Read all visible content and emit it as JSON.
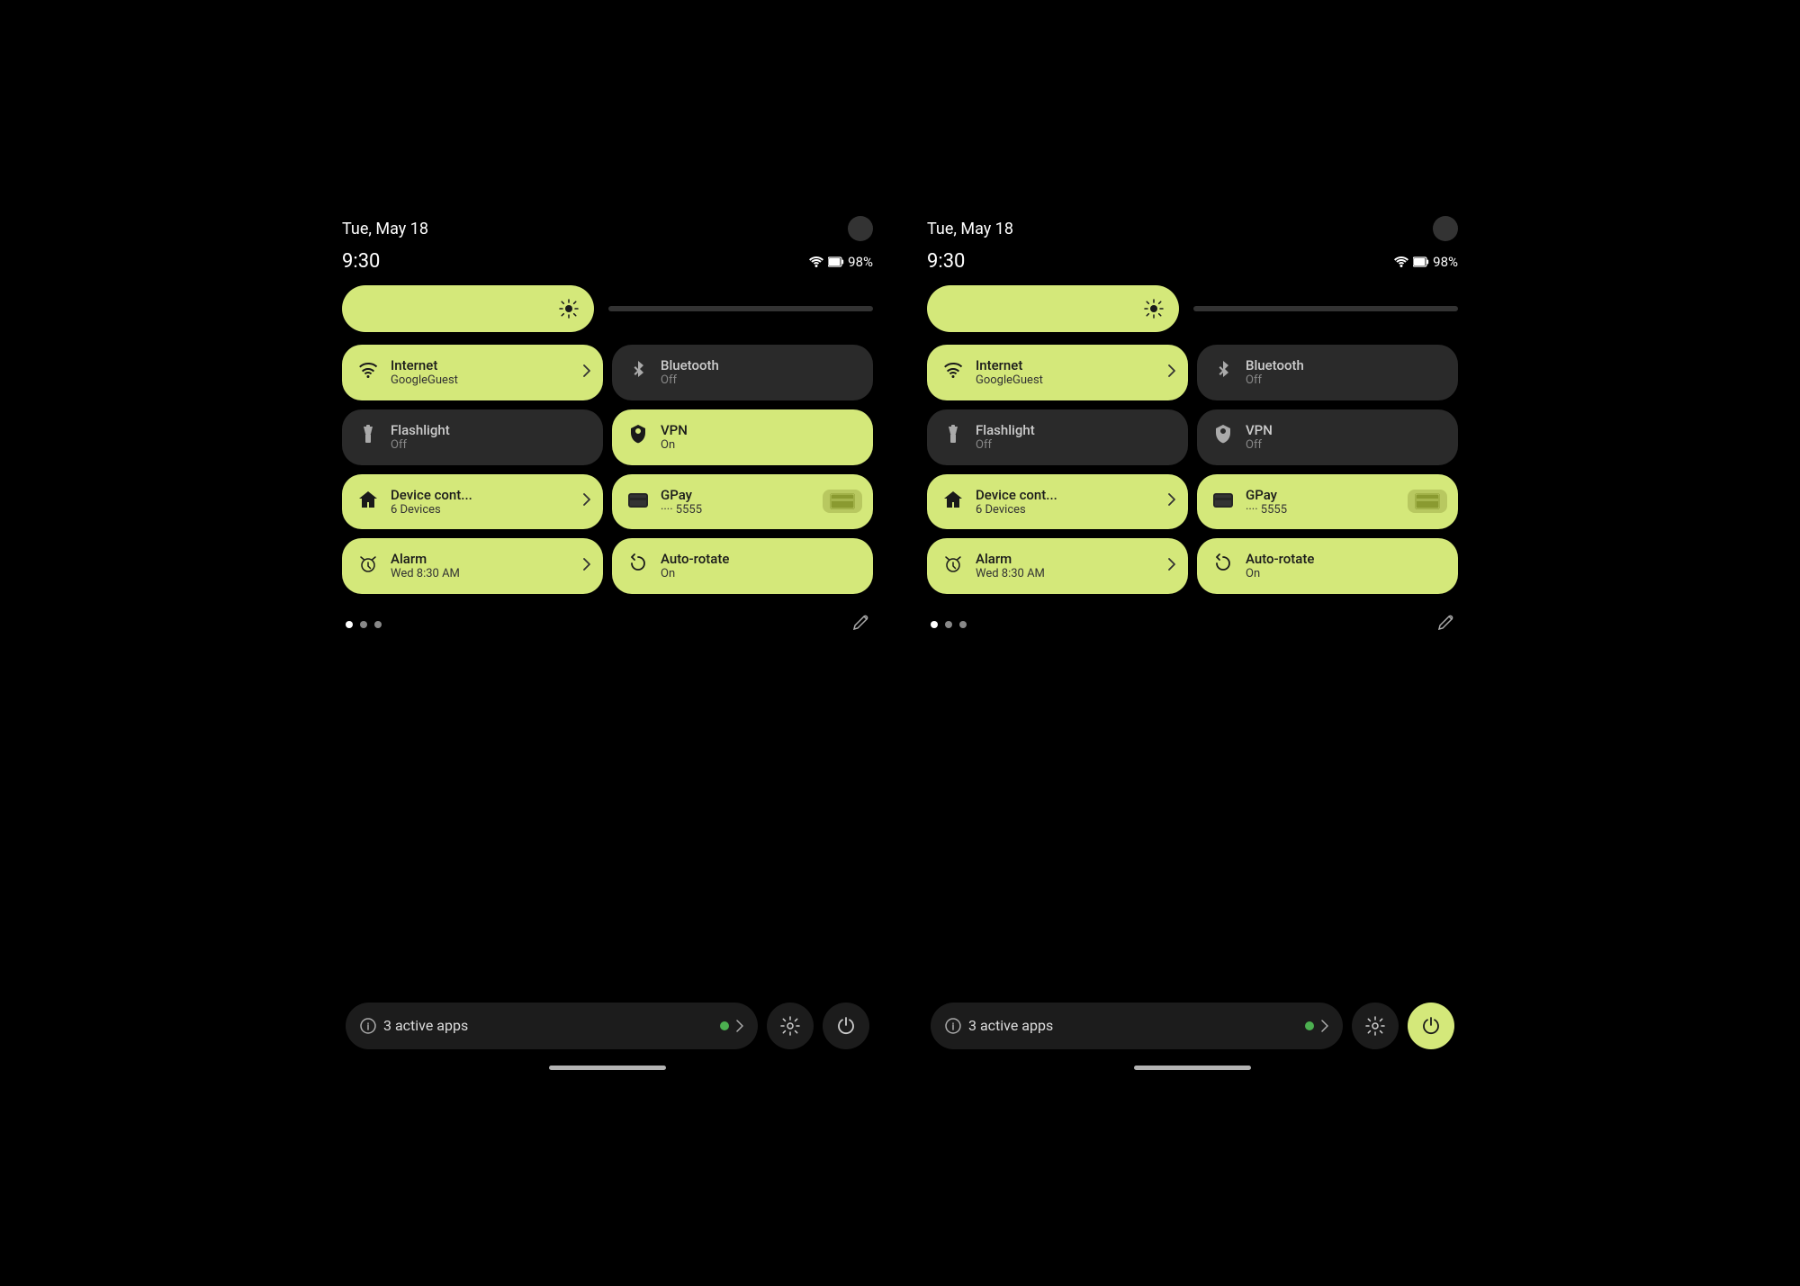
{
  "screens": [
    {
      "id": "screen-left",
      "statusBar": {
        "date": "Tue, May 18",
        "time": "9:30",
        "battery": "98%"
      },
      "brightness": {
        "icon": "⚙"
      },
      "tiles": [
        {
          "id": "internet",
          "state": "active",
          "icon": "wifi",
          "title": "Internet",
          "subtitle": "GoogleGuest",
          "hasChevron": true
        },
        {
          "id": "bluetooth",
          "state": "inactive",
          "icon": "bluetooth",
          "title": "Bluetooth",
          "subtitle": "Off",
          "hasChevron": false
        },
        {
          "id": "flashlight",
          "state": "inactive",
          "icon": "flashlight",
          "title": "Flashlight",
          "subtitle": "Off",
          "hasChevron": false
        },
        {
          "id": "vpn",
          "state": "active",
          "icon": "vpn",
          "title": "VPN",
          "subtitle": "On",
          "hasChevron": false
        },
        {
          "id": "device-control",
          "state": "active",
          "icon": "home",
          "title": "Device cont...",
          "subtitle": "6 Devices",
          "hasChevron": true
        },
        {
          "id": "gpay",
          "state": "active",
          "icon": "gpay",
          "title": "GPay",
          "subtitle": "···· 5555",
          "hasCard": true
        },
        {
          "id": "alarm",
          "state": "active",
          "icon": "alarm",
          "title": "Alarm",
          "subtitle": "Wed 8:30 AM",
          "hasChevron": true
        },
        {
          "id": "autorotate",
          "state": "active",
          "icon": "rotate",
          "title": "Auto-rotate",
          "subtitle": "On",
          "hasChevron": false
        }
      ],
      "dots": [
        true,
        false,
        false
      ],
      "bottomBar": {
        "appsCount": "3 active apps",
        "settingsIcon": "⚙",
        "powerIcon": "⏻",
        "powerActive": false
      }
    },
    {
      "id": "screen-right",
      "statusBar": {
        "date": "Tue, May 18",
        "time": "9:30",
        "battery": "98%"
      },
      "brightness": {
        "icon": "⚙"
      },
      "tiles": [
        {
          "id": "internet",
          "state": "active",
          "icon": "wifi",
          "title": "Internet",
          "subtitle": "GoogleGuest",
          "hasChevron": true
        },
        {
          "id": "bluetooth",
          "state": "inactive",
          "icon": "bluetooth",
          "title": "Bluetooth",
          "subtitle": "Off",
          "hasChevron": false
        },
        {
          "id": "flashlight",
          "state": "inactive",
          "icon": "flashlight",
          "title": "Flashlight",
          "subtitle": "Off",
          "hasChevron": false
        },
        {
          "id": "vpn",
          "state": "inactive",
          "icon": "vpn",
          "title": "VPN",
          "subtitle": "Off",
          "hasChevron": false
        },
        {
          "id": "device-control",
          "state": "active",
          "icon": "home",
          "title": "Device cont...",
          "subtitle": "6 Devices",
          "hasChevron": true
        },
        {
          "id": "gpay",
          "state": "active",
          "icon": "gpay",
          "title": "GPay",
          "subtitle": "···· 5555",
          "hasCard": true
        },
        {
          "id": "alarm",
          "state": "active",
          "icon": "alarm",
          "title": "Alarm",
          "subtitle": "Wed 8:30 AM",
          "hasChevron": true
        },
        {
          "id": "autorotate",
          "state": "active",
          "icon": "rotate",
          "title": "Auto-rotate",
          "subtitle": "On",
          "hasChevron": false
        }
      ],
      "dots": [
        true,
        false,
        false
      ],
      "bottomBar": {
        "appsCount": "3 active apps",
        "settingsIcon": "⚙",
        "powerIcon": "⏻",
        "powerActive": true
      }
    }
  ],
  "icons": {
    "wifi": "▾",
    "bluetooth": "✳",
    "flashlight": "🔦",
    "vpn": "🛡",
    "home": "⌂",
    "gpay": "💳",
    "alarm": "⏰",
    "rotate": "↻",
    "edit": "✏",
    "chevron": "›",
    "info": "ⓘ"
  }
}
